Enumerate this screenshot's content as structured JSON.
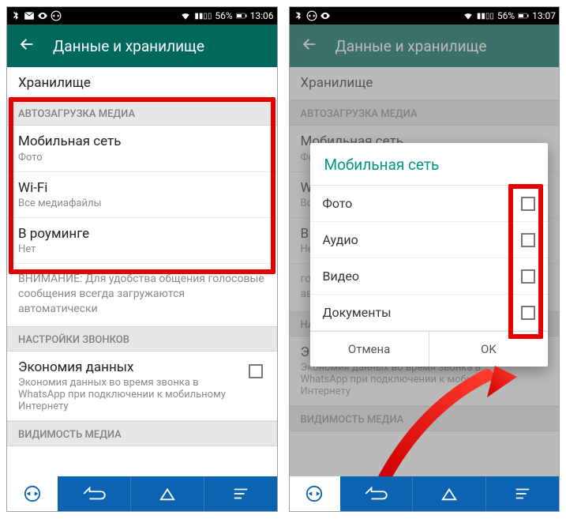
{
  "status": {
    "battery_pct": "56%",
    "time_left": "13:06",
    "time_right": "13:07"
  },
  "header": {
    "title": "Данные и хранилище"
  },
  "sections": {
    "storage_item": "Хранилище",
    "autodownload_header": "АВТОЗАГРУЗКА МЕДИА",
    "mobile": {
      "title": "Мобильная сеть",
      "sub": "Фото"
    },
    "wifi": {
      "title": "Wi-Fi",
      "sub": "Все медиафайлы"
    },
    "roaming": {
      "title": "В роуминге",
      "sub": "Нет"
    },
    "note": "ВНИМАНИЕ: Для удобства общения голосовые сообщения всегда загружаются автоматически",
    "calls_header": "НАСТРОЙКИ ЗВОНКОВ",
    "economy": {
      "title": "Экономия данных",
      "sub": "Экономия данных во время звонка в WhatsApp при подключении к мобильному Интернету"
    },
    "media_vis_header": "ВИДИМОСТЬ МЕДИА"
  },
  "right_truncated": {
    "mobile_sub": "Фо",
    "wifi_sub": "Вс",
    "roaming": "В",
    "roaming_sub": "Не",
    "note_l2": "го",
    "note_l3": "ав"
  },
  "dialog": {
    "title": "Мобильная сеть",
    "options": [
      "Фото",
      "Аудио",
      "Видео",
      "Документы"
    ],
    "cancel": "Отмена",
    "ok": "OK"
  }
}
